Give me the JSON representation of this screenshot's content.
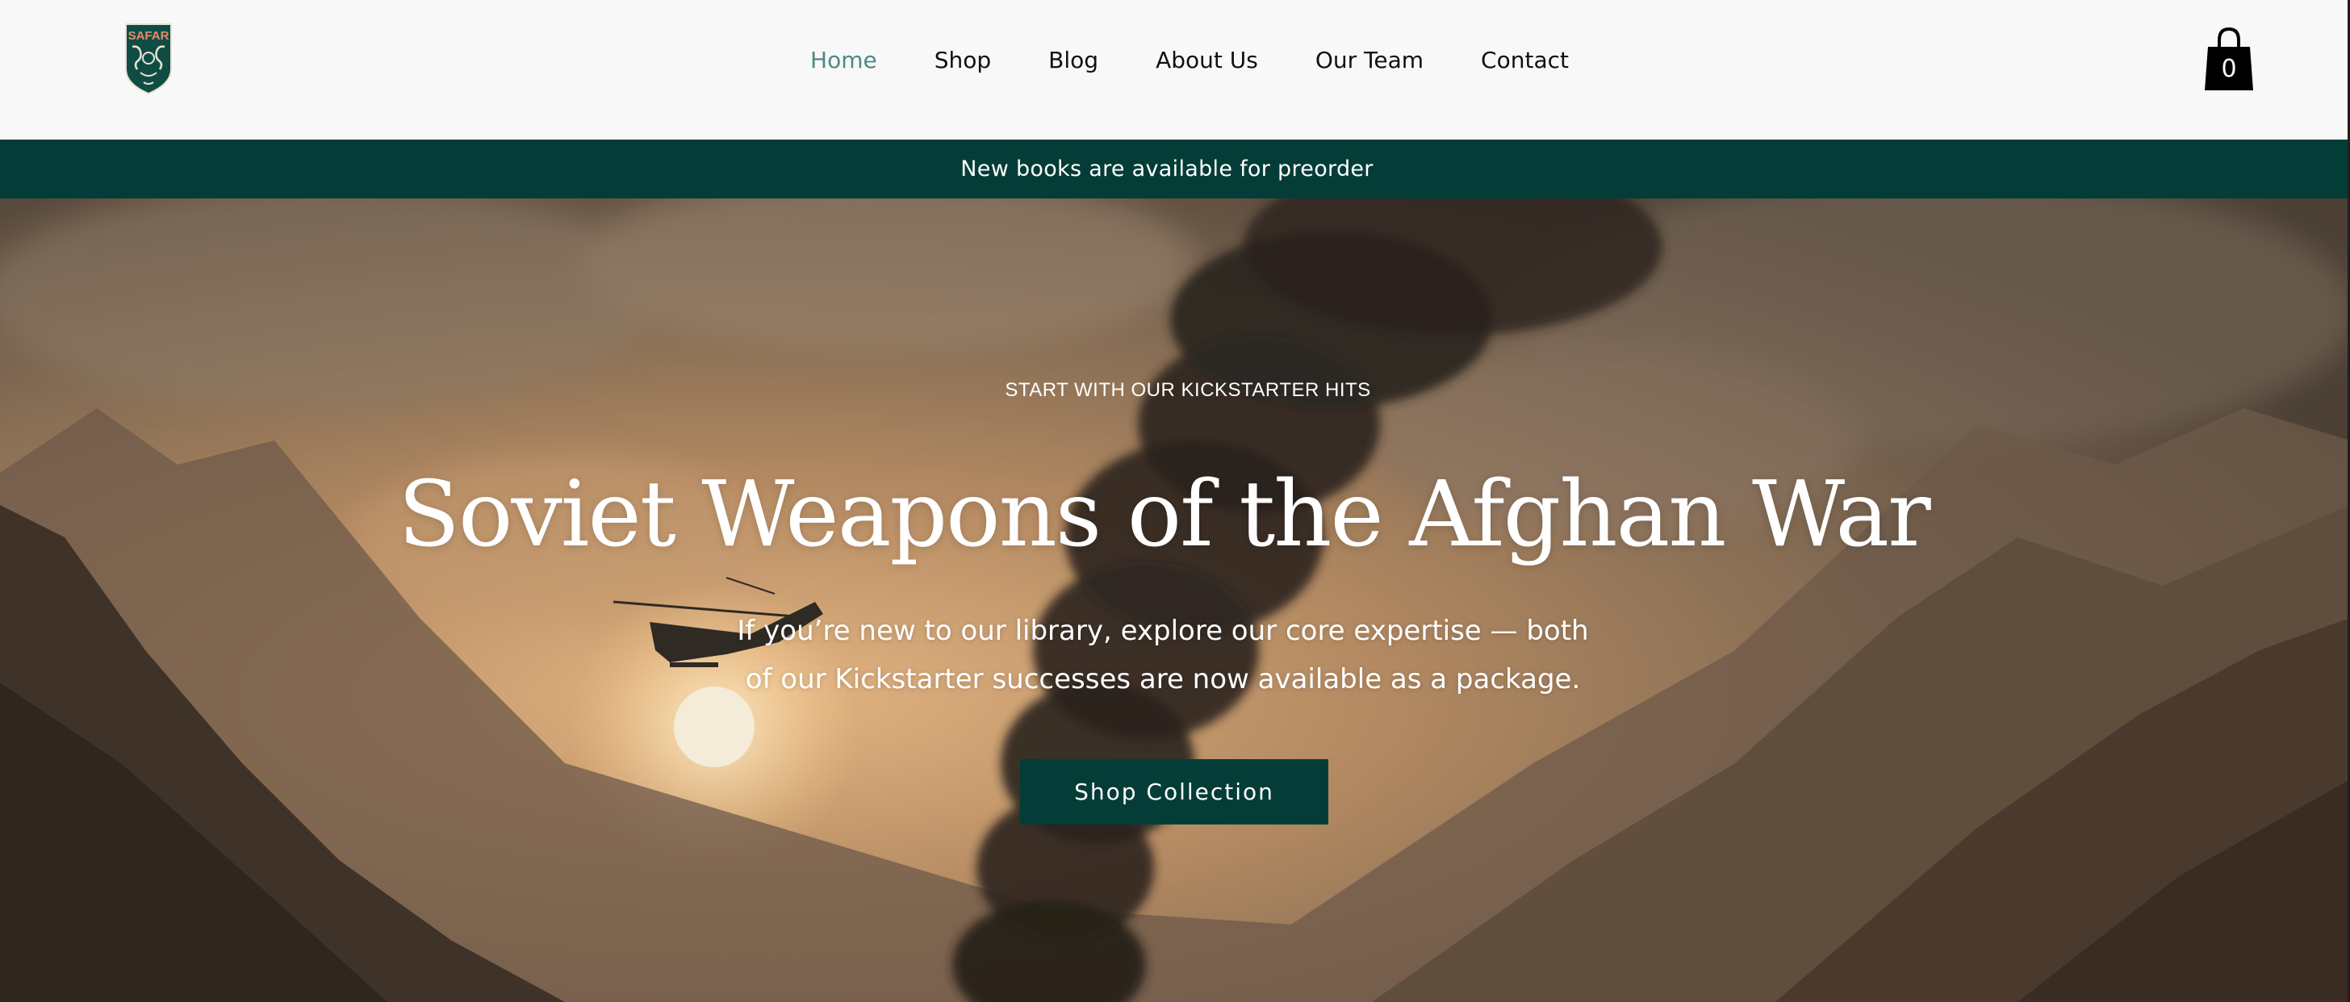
{
  "brand": {
    "logo_text": "SAFAR",
    "colors": {
      "primary": "#043d37",
      "nav_active": "#4f8a83",
      "header_bg": "#f8f8f8"
    }
  },
  "nav": {
    "items": [
      {
        "label": "Home",
        "active": true
      },
      {
        "label": "Shop",
        "active": false
      },
      {
        "label": "Blog",
        "active": false
      },
      {
        "label": "About Us",
        "active": false
      },
      {
        "label": "Our Team",
        "active": false
      },
      {
        "label": "Contact",
        "active": false
      }
    ]
  },
  "cart": {
    "icon": "shopping-bag-icon",
    "count": "0"
  },
  "announcement": {
    "text": "New books are available for preorder"
  },
  "hero": {
    "eyebrow": "START WITH OUR KICKSTARTER HITS",
    "title": "Soviet Weapons of the Afghan War",
    "description": "If you’re new to our library, explore our core expertise — both of our Kickstarter successes are now available as a package.",
    "cta_label": "Shop Collection",
    "background": "mountains-smoke-helicopter-image"
  }
}
